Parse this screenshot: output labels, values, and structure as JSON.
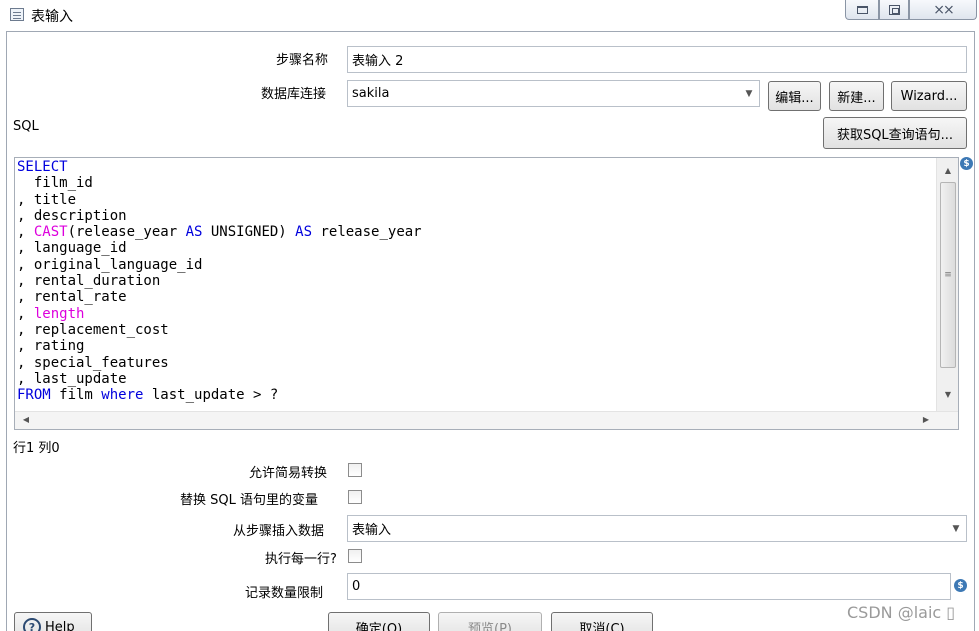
{
  "window": {
    "title": "表输入",
    "minimize_icon": "minimize-icon",
    "maximize_icon": "maximize-icon",
    "close_symbol": "⨯⨯"
  },
  "step_name": {
    "label": "步骤名称",
    "value": "表输入 2"
  },
  "connection": {
    "label": "数据库连接",
    "value": "sakila",
    "edit_button": "编辑...",
    "new_button": "新建...",
    "wizard_button": "Wizard..."
  },
  "sql": {
    "label": "SQL",
    "get_sql_button": "获取SQL查询语句...",
    "lines": [
      [
        {
          "t": "SELECT",
          "c": "b"
        }
      ],
      [
        {
          "t": "  film_id",
          "c": ""
        }
      ],
      [
        {
          "t": ", title",
          "c": ""
        }
      ],
      [
        {
          "t": ", description",
          "c": ""
        }
      ],
      [
        {
          "t": ", ",
          "c": ""
        },
        {
          "t": "CAST",
          "c": "m"
        },
        {
          "t": "(release_year ",
          "c": ""
        },
        {
          "t": "AS",
          "c": "b"
        },
        {
          "t": " UNSIGNED) ",
          "c": ""
        },
        {
          "t": "AS",
          "c": "b"
        },
        {
          "t": " release_year",
          "c": ""
        }
      ],
      [
        {
          "t": ", language_id",
          "c": ""
        }
      ],
      [
        {
          "t": ", original_language_id",
          "c": ""
        }
      ],
      [
        {
          "t": ", rental_duration",
          "c": ""
        }
      ],
      [
        {
          "t": ", rental_rate",
          "c": ""
        }
      ],
      [
        {
          "t": ", ",
          "c": ""
        },
        {
          "t": "length",
          "c": "m"
        }
      ],
      [
        {
          "t": ", replacement_cost",
          "c": ""
        }
      ],
      [
        {
          "t": ", rating",
          "c": ""
        }
      ],
      [
        {
          "t": ", special_features",
          "c": ""
        }
      ],
      [
        {
          "t": ", last_update",
          "c": ""
        }
      ],
      [
        {
          "t": "FROM",
          "c": "b"
        },
        {
          "t": " film ",
          "c": ""
        },
        {
          "t": "where",
          "c": "b"
        },
        {
          "t": " last_update > ?",
          "c": ""
        }
      ]
    ],
    "colors": {
      "keyword": "#0000dd",
      "function": "#dd00dd"
    },
    "variable_icon_glyph": "$",
    "scroll_thumb_glyph": "≡"
  },
  "position": "行1 列0",
  "options": {
    "lazy_conversion_label": "允许简易转换",
    "replace_vars_label": "替换 SQL 语句里的变量",
    "insert_from_step": {
      "label": "从步骤插入数据",
      "value": "表输入"
    },
    "execute_each_row_label": "执行每一行?",
    "limit": {
      "label": "记录数量限制",
      "value": "0"
    }
  },
  "footer": {
    "help_button": "Help",
    "ok_button": "确定(O)",
    "preview_button": "预览(P)",
    "cancel_button": "取消(C)"
  },
  "watermark": "CSDN @laic ▯"
}
